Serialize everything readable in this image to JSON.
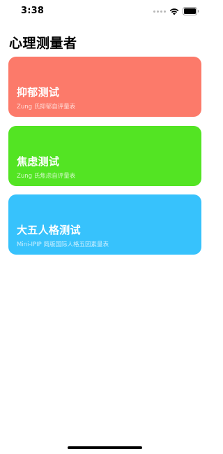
{
  "status_bar": {
    "time": "3:38",
    "icons": [
      "signal-dots-icon",
      "wifi-icon",
      "battery-icon"
    ]
  },
  "header": {
    "title": "心理测量者"
  },
  "cards": [
    {
      "title": "抑郁测试",
      "subtitle": "Zung 氏抑郁自评量表",
      "color": "#fc7a6a"
    },
    {
      "title": "焦虑测试",
      "subtitle": "Zung 氏焦虑自评量表",
      "color": "#53e423"
    },
    {
      "title": "大五人格测试",
      "subtitle": "Mini-IPIP 简版国际人格五因素量表",
      "color": "#37c2fc"
    }
  ]
}
